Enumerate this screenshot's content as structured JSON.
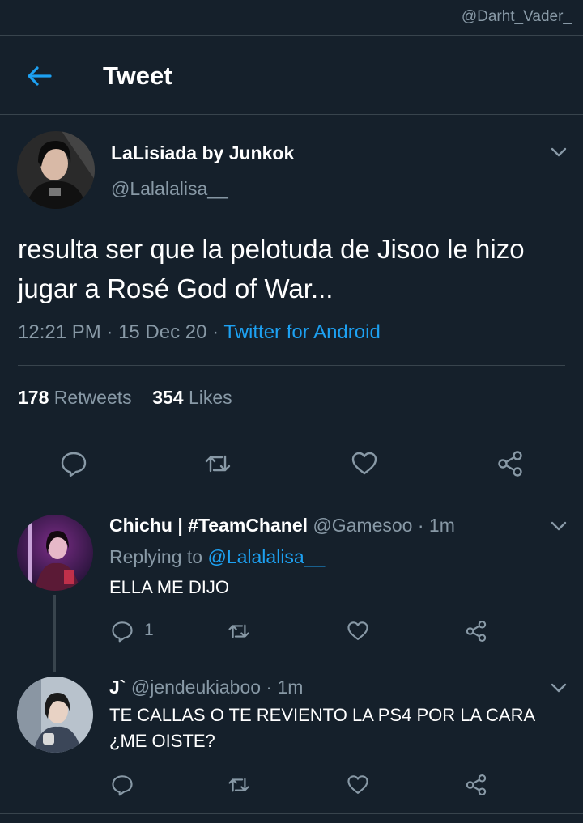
{
  "watermark": "@Darht_Vader_",
  "header": {
    "title": "Tweet",
    "back_icon": "back-arrow-icon"
  },
  "tweet": {
    "author_name": "LaLisiada by Junkok",
    "author_handle": "@Lalalalisa__",
    "text": "resulta ser que la pelotuda de Jisoo le hizo jugar a Rosé God of War...",
    "time": "12:21 PM",
    "sep1": " · ",
    "date": "15 Dec 20",
    "sep2": " · ",
    "source": "Twitter for Android",
    "retweets_count": "178",
    "retweets_label": "Retweets",
    "likes_count": "354",
    "likes_label": "Likes"
  },
  "replies": [
    {
      "name": "Chichu | #TeamChanel",
      "handle_time": "@Gamesoo · 1m",
      "replying_prefix": "Replying to ",
      "replying_handle": "@Lalalalisa__",
      "text": "ELLA ME DIJO",
      "reply_count": "1"
    },
    {
      "name": "J`",
      "handle_time": "@jendeukiaboo · 1m",
      "text": "TE CALLAS O TE REVIENTO LA PS4 POR LA CARA ¿ME OISTE?"
    }
  ],
  "colors": {
    "background": "#15202b",
    "accent": "#1da1f2",
    "muted": "#8899a6",
    "divider": "#38444d"
  }
}
